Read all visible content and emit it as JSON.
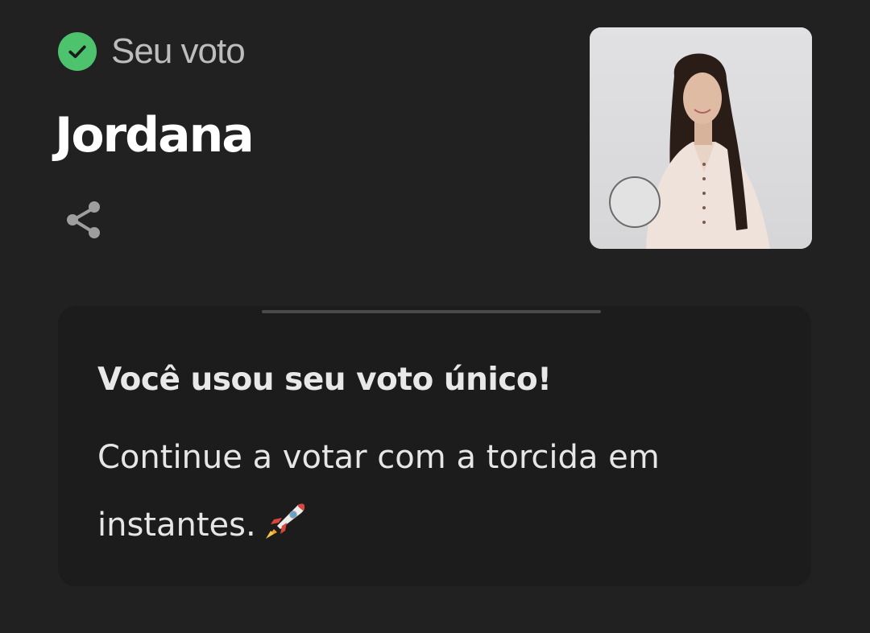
{
  "status": {
    "label": "Seu voto",
    "icon": "check-circle-icon",
    "color": "#4cc36c"
  },
  "candidate": {
    "name": "Jordana",
    "photo_alt": "Jordana"
  },
  "actions": {
    "share_icon": "share-icon"
  },
  "message": {
    "title": "Você usou seu voto único!",
    "body": "Continue a votar com a torcida em instantes.",
    "emoji_icon": "rocket-icon"
  }
}
